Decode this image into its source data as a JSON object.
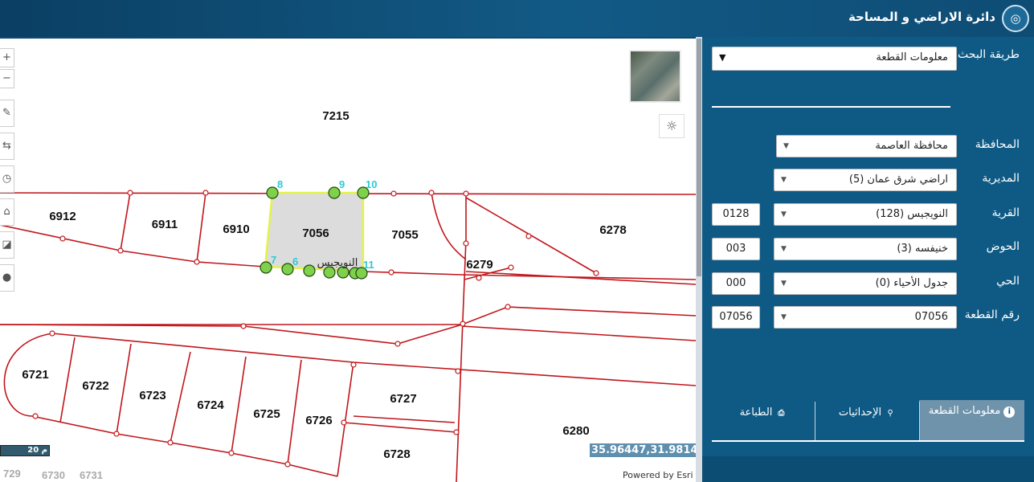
{
  "header": {
    "title": "دائرة الاراضي و المساحة",
    "logo_icon": "dls-logo-icon"
  },
  "map": {
    "coords": "35.96447,31.98149",
    "powered_by": "Powered by Esri",
    "scale_label": "20 م",
    "parcel_labels": {
      "p7215": "7215",
      "p6912": "6912",
      "p6911": "6911",
      "p6910": "6910",
      "p7056": "7056",
      "p7055": "7055",
      "p6278": "6278",
      "p6279": "6279",
      "p6721": "6721",
      "p6722": "6722",
      "p6723": "6723",
      "p6724": "6724",
      "p6725": "6725",
      "p6726": "6726",
      "p6727": "6727",
      "p6728": "6728",
      "p6280": "6280",
      "p729": "729",
      "p6730": "6730",
      "p6731": "6731"
    },
    "vertex_labels": {
      "v8": "8",
      "v9": "9",
      "v10": "10",
      "v7": "7",
      "v6": "6",
      "v11": "11"
    },
    "street_label": "النويجيس"
  },
  "panel": {
    "search_method": {
      "label": "طريقة البحث",
      "value": "معلومات القطعة"
    },
    "governorate": {
      "label": "المحافظة",
      "value": "محافظة العاصمة"
    },
    "directorate": {
      "label": "المديرية",
      "value": "اراضي شرق عمان (5)"
    },
    "village": {
      "label": "القرية",
      "value": "النويجيس (128)",
      "code": "0128"
    },
    "basin": {
      "label": "الحوض",
      "value": "خنيفسه (3)",
      "code": "003"
    },
    "neighborhood": {
      "label": "الحي",
      "value": "جدول الأحياء (0)",
      "code": "000"
    },
    "parcel": {
      "label": "رقم القطعة",
      "value": "07056",
      "code": "07056"
    },
    "tabs": [
      {
        "label": "معلومات القطعة",
        "icon": "info-icon",
        "active": true
      },
      {
        "label": "الإحداثيات",
        "icon": "pin-icon",
        "active": false
      },
      {
        "label": "الطباعة",
        "icon": "printer-icon",
        "active": false
      }
    ]
  },
  "colors": {
    "parcel_line": "#c0161b",
    "highlight": "#e4f24a",
    "vertex": "#7fd04b",
    "header": "#0b3f63",
    "panel": "#0f5a85"
  }
}
